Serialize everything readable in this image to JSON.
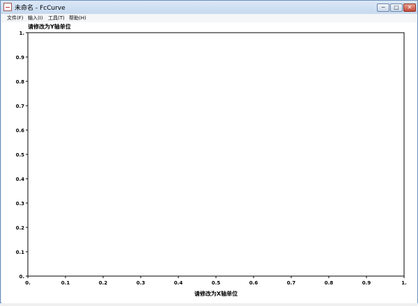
{
  "window": {
    "title": "未命名 - FcCurve",
    "minimize_glyph": "─",
    "maximize_glyph": "□",
    "close_glyph": "✕"
  },
  "menu": [
    {
      "label": "文件(F)"
    },
    {
      "label": "输入(I)"
    },
    {
      "label": "工具(T)"
    },
    {
      "label": "帮助(H)"
    }
  ],
  "chart_data": {
    "type": "line",
    "series": [],
    "ylabel": "请修改为Y轴单位",
    "xlabel": "请修改为X轴单位",
    "xlim": [
      0,
      1
    ],
    "ylim": [
      0,
      1
    ],
    "xticks": [
      "0.",
      "0.1",
      "0.2",
      "0.3",
      "0.4",
      "0.5",
      "0.6",
      "0.7",
      "0.8",
      "0.9",
      "1."
    ],
    "yticks": [
      "1.",
      "0.9",
      "0.8",
      "0.7",
      "0.6",
      "0.5",
      "0.4",
      "0.3",
      "0.2",
      "0.1",
      "0."
    ],
    "grid": false
  }
}
